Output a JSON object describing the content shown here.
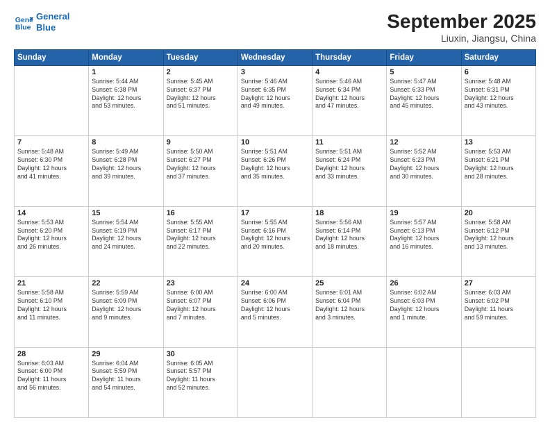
{
  "header": {
    "logo_line1": "General",
    "logo_line2": "Blue",
    "title": "September 2025",
    "subtitle": "Liuxin, Jiangsu, China"
  },
  "weekdays": [
    "Sunday",
    "Monday",
    "Tuesday",
    "Wednesday",
    "Thursday",
    "Friday",
    "Saturday"
  ],
  "weeks": [
    [
      {
        "day": "",
        "info": ""
      },
      {
        "day": "1",
        "info": "Sunrise: 5:44 AM\nSunset: 6:38 PM\nDaylight: 12 hours\nand 53 minutes."
      },
      {
        "day": "2",
        "info": "Sunrise: 5:45 AM\nSunset: 6:37 PM\nDaylight: 12 hours\nand 51 minutes."
      },
      {
        "day": "3",
        "info": "Sunrise: 5:46 AM\nSunset: 6:35 PM\nDaylight: 12 hours\nand 49 minutes."
      },
      {
        "day": "4",
        "info": "Sunrise: 5:46 AM\nSunset: 6:34 PM\nDaylight: 12 hours\nand 47 minutes."
      },
      {
        "day": "5",
        "info": "Sunrise: 5:47 AM\nSunset: 6:33 PM\nDaylight: 12 hours\nand 45 minutes."
      },
      {
        "day": "6",
        "info": "Sunrise: 5:48 AM\nSunset: 6:31 PM\nDaylight: 12 hours\nand 43 minutes."
      }
    ],
    [
      {
        "day": "7",
        "info": "Sunrise: 5:48 AM\nSunset: 6:30 PM\nDaylight: 12 hours\nand 41 minutes."
      },
      {
        "day": "8",
        "info": "Sunrise: 5:49 AM\nSunset: 6:28 PM\nDaylight: 12 hours\nand 39 minutes."
      },
      {
        "day": "9",
        "info": "Sunrise: 5:50 AM\nSunset: 6:27 PM\nDaylight: 12 hours\nand 37 minutes."
      },
      {
        "day": "10",
        "info": "Sunrise: 5:51 AM\nSunset: 6:26 PM\nDaylight: 12 hours\nand 35 minutes."
      },
      {
        "day": "11",
        "info": "Sunrise: 5:51 AM\nSunset: 6:24 PM\nDaylight: 12 hours\nand 33 minutes."
      },
      {
        "day": "12",
        "info": "Sunrise: 5:52 AM\nSunset: 6:23 PM\nDaylight: 12 hours\nand 30 minutes."
      },
      {
        "day": "13",
        "info": "Sunrise: 5:53 AM\nSunset: 6:21 PM\nDaylight: 12 hours\nand 28 minutes."
      }
    ],
    [
      {
        "day": "14",
        "info": "Sunrise: 5:53 AM\nSunset: 6:20 PM\nDaylight: 12 hours\nand 26 minutes."
      },
      {
        "day": "15",
        "info": "Sunrise: 5:54 AM\nSunset: 6:19 PM\nDaylight: 12 hours\nand 24 minutes."
      },
      {
        "day": "16",
        "info": "Sunrise: 5:55 AM\nSunset: 6:17 PM\nDaylight: 12 hours\nand 22 minutes."
      },
      {
        "day": "17",
        "info": "Sunrise: 5:55 AM\nSunset: 6:16 PM\nDaylight: 12 hours\nand 20 minutes."
      },
      {
        "day": "18",
        "info": "Sunrise: 5:56 AM\nSunset: 6:14 PM\nDaylight: 12 hours\nand 18 minutes."
      },
      {
        "day": "19",
        "info": "Sunrise: 5:57 AM\nSunset: 6:13 PM\nDaylight: 12 hours\nand 16 minutes."
      },
      {
        "day": "20",
        "info": "Sunrise: 5:58 AM\nSunset: 6:12 PM\nDaylight: 12 hours\nand 13 minutes."
      }
    ],
    [
      {
        "day": "21",
        "info": "Sunrise: 5:58 AM\nSunset: 6:10 PM\nDaylight: 12 hours\nand 11 minutes."
      },
      {
        "day": "22",
        "info": "Sunrise: 5:59 AM\nSunset: 6:09 PM\nDaylight: 12 hours\nand 9 minutes."
      },
      {
        "day": "23",
        "info": "Sunrise: 6:00 AM\nSunset: 6:07 PM\nDaylight: 12 hours\nand 7 minutes."
      },
      {
        "day": "24",
        "info": "Sunrise: 6:00 AM\nSunset: 6:06 PM\nDaylight: 12 hours\nand 5 minutes."
      },
      {
        "day": "25",
        "info": "Sunrise: 6:01 AM\nSunset: 6:04 PM\nDaylight: 12 hours\nand 3 minutes."
      },
      {
        "day": "26",
        "info": "Sunrise: 6:02 AM\nSunset: 6:03 PM\nDaylight: 12 hours\nand 1 minute."
      },
      {
        "day": "27",
        "info": "Sunrise: 6:03 AM\nSunset: 6:02 PM\nDaylight: 11 hours\nand 59 minutes."
      }
    ],
    [
      {
        "day": "28",
        "info": "Sunrise: 6:03 AM\nSunset: 6:00 PM\nDaylight: 11 hours\nand 56 minutes."
      },
      {
        "day": "29",
        "info": "Sunrise: 6:04 AM\nSunset: 5:59 PM\nDaylight: 11 hours\nand 54 minutes."
      },
      {
        "day": "30",
        "info": "Sunrise: 6:05 AM\nSunset: 5:57 PM\nDaylight: 11 hours\nand 52 minutes."
      },
      {
        "day": "",
        "info": ""
      },
      {
        "day": "",
        "info": ""
      },
      {
        "day": "",
        "info": ""
      },
      {
        "day": "",
        "info": ""
      }
    ]
  ]
}
